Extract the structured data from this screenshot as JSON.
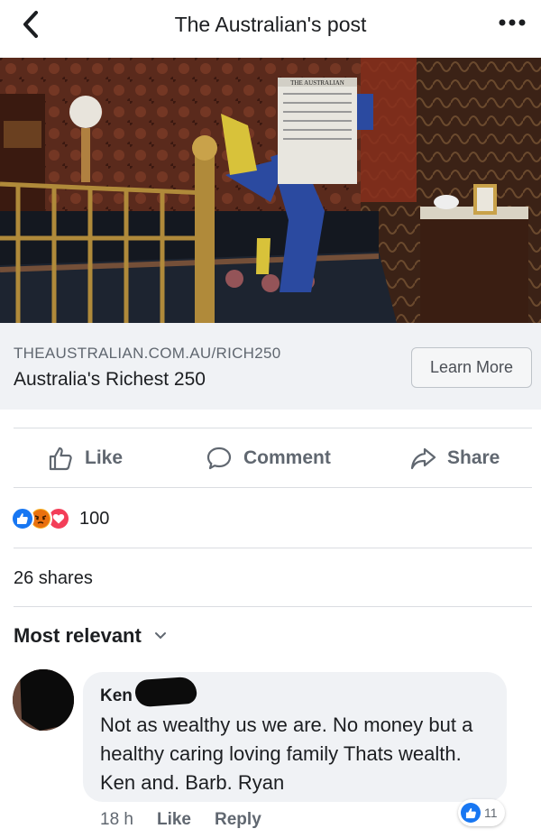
{
  "header": {
    "title": "The Australian's post",
    "back_icon": "chevron-left-icon",
    "more_icon": "more-dots-icon"
  },
  "hero": {
    "newspaper_masthead": "THE AUSTRALIAN"
  },
  "link_preview": {
    "domain": "THEAUSTRALIAN.COM.AU/RICH250",
    "title": "Australia's Richest 250",
    "cta_label": "Learn More"
  },
  "actions": {
    "like_label": "Like",
    "comment_label": "Comment",
    "share_label": "Share"
  },
  "reactions": {
    "icons": [
      "like-reaction-icon",
      "angry-reaction-icon",
      "love-reaction-icon"
    ],
    "count": "100"
  },
  "shares_text": "26 shares",
  "sort": {
    "label": "Most relevant"
  },
  "comment": {
    "author": "Ken",
    "text": "Not as wealthy us we are. No money but a healthy caring loving family Thats wealth.  Ken and. Barb. Ryan",
    "time": "18 h",
    "like_label": "Like",
    "reply_label": "Reply",
    "like_count": "11"
  },
  "colors": {
    "brand_blue": "#1877f2",
    "angry_orange": "#f7b125",
    "love_red": "#f33e58",
    "muted_text": "#606770"
  }
}
